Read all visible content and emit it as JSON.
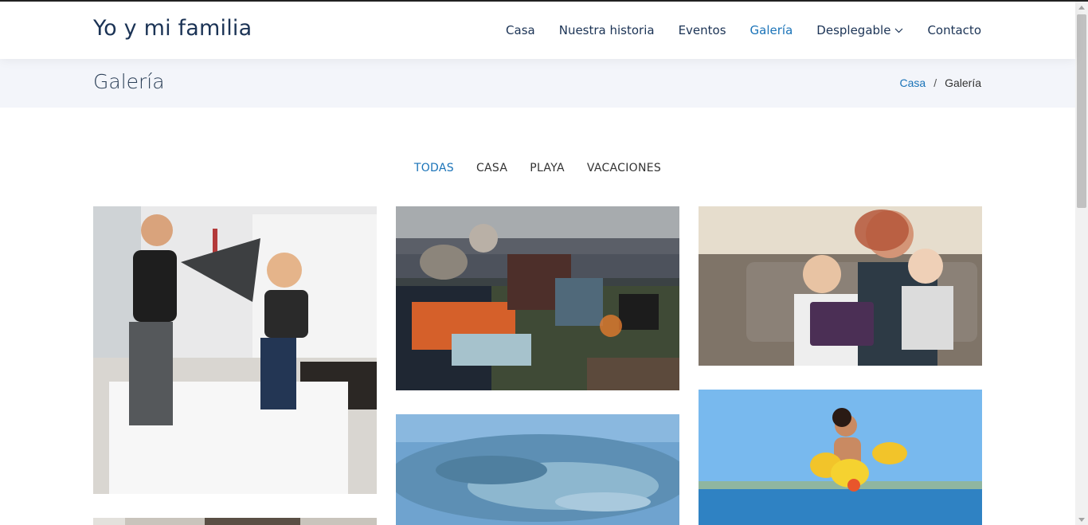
{
  "site": {
    "logo": "Yo y mi familia"
  },
  "nav": {
    "items": [
      {
        "label": "Casa"
      },
      {
        "label": "Nuestra historia"
      },
      {
        "label": "Eventos"
      },
      {
        "label": "Galería",
        "active": true
      },
      {
        "label": "Desplegable",
        "has_dropdown": true
      },
      {
        "label": "Contacto"
      }
    ]
  },
  "page": {
    "title": "Galería"
  },
  "breadcrumb": {
    "home": "Casa",
    "separator": "/",
    "current": "Galería"
  },
  "filters": [
    "TODAS",
    "CASA",
    "PLAYA",
    "VACACIONES"
  ],
  "gallery": [
    {
      "name": "pillow-fight-photo"
    },
    {
      "name": "campfire-group-photo"
    },
    {
      "name": "mother-children-tablet-photo"
    },
    {
      "name": "aerial-landscape-photo"
    },
    {
      "name": "child-beach-floaties-photo"
    },
    {
      "name": "family-partial-photo"
    }
  ],
  "colors": {
    "accent": "#1a73b8",
    "text": "#1b3355",
    "title_bar": "#f3f5fa"
  }
}
